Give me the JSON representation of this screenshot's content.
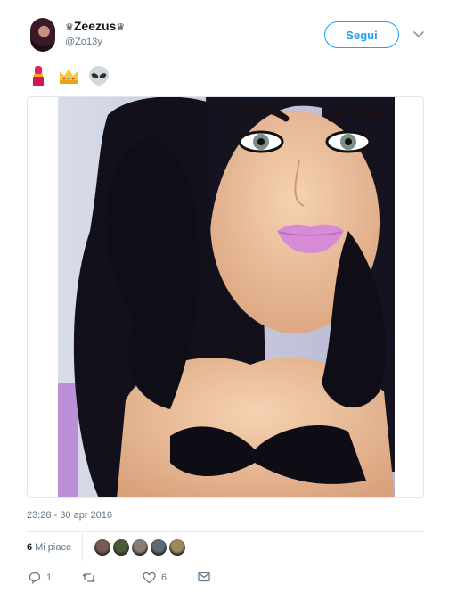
{
  "user": {
    "display_name": "Zeezus",
    "crown_glyph": "♛",
    "handle": "@Zo13y"
  },
  "follow_button": {
    "label": "Segui"
  },
  "tweet": {
    "emojis": [
      "lipstick-icon",
      "crown-icon",
      "alien-icon"
    ],
    "photo": {
      "alt": ""
    },
    "timestamp": "23:28 - 30 apr 2016"
  },
  "stats": {
    "likes_number": "6",
    "likes_label": "Mi piace",
    "liker_colors": [
      "#7a5a52",
      "#4b5a3a",
      "#8a7e74",
      "#5e6a72",
      "#9a8a5a"
    ]
  },
  "actions": {
    "reply_count": "1",
    "retweet_count": "",
    "like_count": "6"
  },
  "colors": {
    "accent": "#1da1f2",
    "muted": "#657786",
    "text": "#14171a"
  }
}
